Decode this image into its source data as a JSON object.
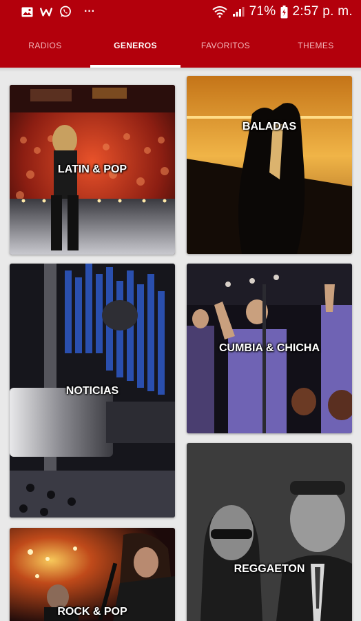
{
  "status_bar": {
    "icons_left": [
      "image-icon",
      "w-app-icon",
      "whatsapp-icon",
      "more-icon"
    ],
    "more": "···",
    "battery_percent": "71%",
    "time": "2:57 p. m."
  },
  "tabs": [
    {
      "label": "RADIOS",
      "active": false
    },
    {
      "label": "GENEROS",
      "active": true
    },
    {
      "label": "FAVORITOS",
      "active": false
    },
    {
      "label": "THEMES",
      "active": false
    }
  ],
  "genres": [
    {
      "label": "LATIN & POP"
    },
    {
      "label": "BALADAS"
    },
    {
      "label": "NOTICIAS"
    },
    {
      "label": "CUMBIA & CHICHA"
    },
    {
      "label": "REGGAETON"
    },
    {
      "label": "ROCK & POP"
    }
  ],
  "colors": {
    "brand_red": "#b3000c",
    "background": "#e9e9e9"
  }
}
